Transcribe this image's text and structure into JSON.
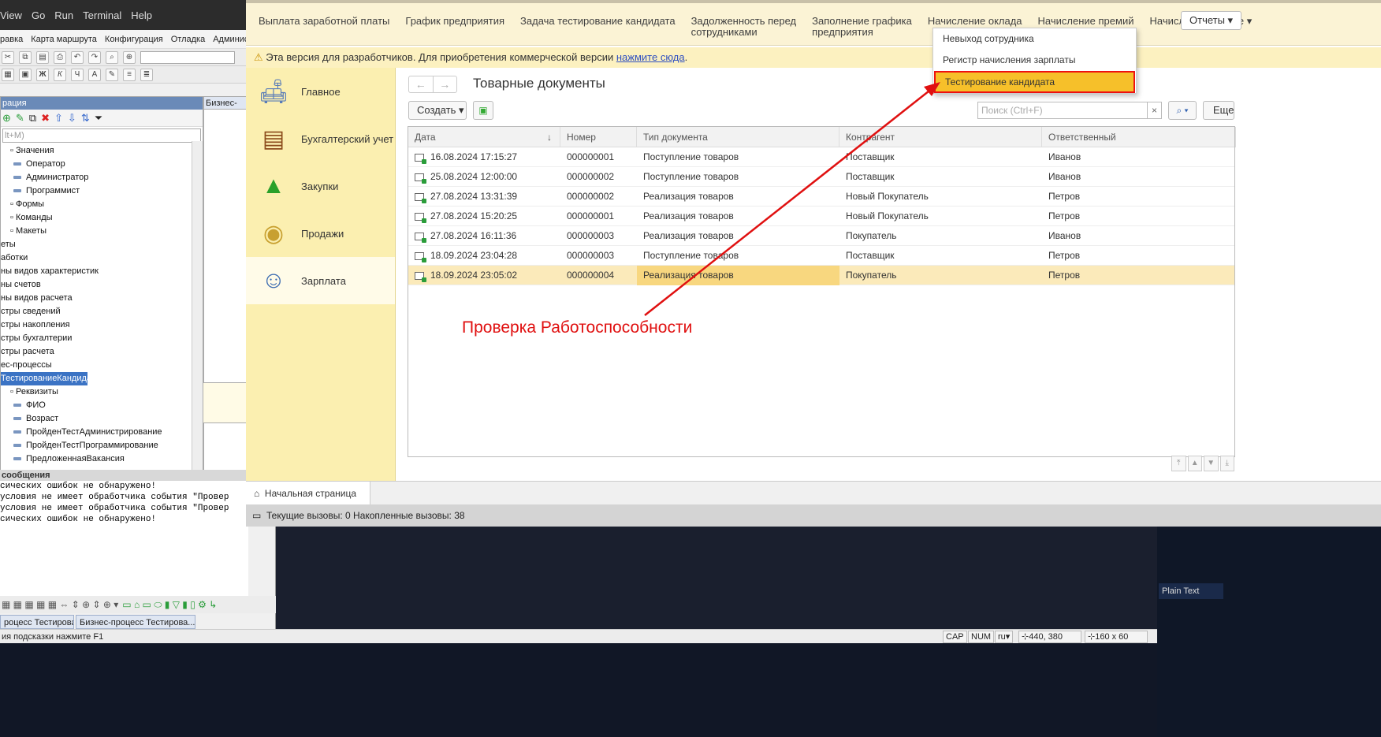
{
  "vscode_menu": [
    "View",
    "Go",
    "Run",
    "Terminal",
    "Help"
  ],
  "configurator": {
    "menu": [
      "равка",
      "Карта маршрута",
      "Конфигурация",
      "Отладка",
      "Администрирова"
    ],
    "tree_title": "рация",
    "tree_search_placeholder": "lt+M)",
    "tree_items": [
      {
        "label": "Значения",
        "indent": 0,
        "kind": "node"
      },
      {
        "label": "Оператор",
        "indent": 1,
        "kind": "leaf"
      },
      {
        "label": "Администратор",
        "indent": 1,
        "kind": "leaf"
      },
      {
        "label": "Программист",
        "indent": 1,
        "kind": "leaf"
      },
      {
        "label": "Формы",
        "indent": 0,
        "kind": "node"
      },
      {
        "label": "Команды",
        "indent": 0,
        "kind": "node"
      },
      {
        "label": "Макеты",
        "indent": 0,
        "kind": "node"
      },
      {
        "label": "еты",
        "indent": -1,
        "kind": "plain"
      },
      {
        "label": "аботки",
        "indent": -1,
        "kind": "plain"
      },
      {
        "label": "ны видов характеристик",
        "indent": -1,
        "kind": "plain"
      },
      {
        "label": "ны счетов",
        "indent": -1,
        "kind": "plain"
      },
      {
        "label": "ны видов расчета",
        "indent": -1,
        "kind": "plain"
      },
      {
        "label": "стры сведений",
        "indent": -1,
        "kind": "plain"
      },
      {
        "label": "стры накопления",
        "indent": -1,
        "kind": "plain"
      },
      {
        "label": "стры бухгалтерии",
        "indent": -1,
        "kind": "plain"
      },
      {
        "label": "стры расчета",
        "indent": -1,
        "kind": "plain"
      },
      {
        "label": "ес-процессы",
        "indent": -1,
        "kind": "plain"
      },
      {
        "label": "ТестированиеКандидата",
        "indent": -1,
        "kind": "selected"
      },
      {
        "label": "Реквизиты",
        "indent": 0,
        "kind": "node"
      },
      {
        "label": "ФИО",
        "indent": 1,
        "kind": "leaf"
      },
      {
        "label": "Возраст",
        "indent": 1,
        "kind": "leaf"
      },
      {
        "label": "ПройденТестАдминистрирование",
        "indent": 1,
        "kind": "leaf"
      },
      {
        "label": "ПройденТестПрограммирование",
        "indent": 1,
        "kind": "leaf"
      },
      {
        "label": "ПредложеннаяВакансия",
        "indent": 1,
        "kind": "leaf"
      }
    ],
    "biz_tab": "Бизнес-",
    "messages_title": "сообщения",
    "messages": [
      "сических ошибок не обнаружено!",
      "условия не имеет обработчика события \"Провер",
      "условия не имеет обработчика события \"Провер",
      "сических ошибок не обнаружено!"
    ],
    "tasks": [
      "роцесс Тестирова...",
      "Бизнес-процесс Тестирова..."
    ],
    "status_hint": "ия подсказки нажмите F1",
    "status_cap": "CAP",
    "status_num": "NUM",
    "status_lang": "ru▾",
    "status_pos": "440, 380",
    "status_size": "160 x 60"
  },
  "enterprise": {
    "top_nav": [
      "Выплата заработной платы",
      "График предприятия",
      "Задача тестирование кандидата",
      "Задолженность перед\nсотрудниками",
      "Заполнение графика\nпредприятия",
      "Начисление оклада",
      "Начисление премий",
      "Начисления",
      "Еще ▾"
    ],
    "reports_label": "Отчеты ▾",
    "warning_text": "Эта версия для разработчиков. Для приобретения коммерческой версии ",
    "warning_link": "нажмите сюда",
    "warning_tail": ".",
    "sections": [
      {
        "label": "Главное",
        "icon": "desk-lamp-icon"
      },
      {
        "label": "Бухгалтерский учет",
        "icon": "cabinet-icon"
      },
      {
        "label": "Закупки",
        "icon": "green-arrow-up-icon"
      },
      {
        "label": "Продажи",
        "icon": "coins-icon"
      },
      {
        "label": "Зарплата",
        "icon": "person-icon"
      }
    ],
    "doc_title": "Товарные документы",
    "create_label": "Создать ▾",
    "search_placeholder": "Поиск (Ctrl+F)",
    "more_label": "Еще",
    "columns": [
      "Дата",
      "Номер",
      "Тип документа",
      "Контрагент",
      "Ответственный"
    ],
    "rows": [
      [
        "16.08.2024 17:15:27",
        "000000001",
        "Поступление товаров",
        "Поставщик",
        "Иванов"
      ],
      [
        "25.08.2024 12:00:00",
        "000000002",
        "Поступление товаров",
        "Поставщик",
        "Иванов"
      ],
      [
        "27.08.2024 13:31:39",
        "000000002",
        "Реализация товаров",
        "Новый Покупатель",
        "Петров"
      ],
      [
        "27.08.2024 15:20:25",
        "000000001",
        "Реализация товаров",
        "Новый Покупатель",
        "Петров"
      ],
      [
        "27.08.2024 16:11:36",
        "000000003",
        "Реализация товаров",
        "Покупатель",
        "Иванов"
      ],
      [
        "18.09.2024 23:04:28",
        "000000003",
        "Поступление товаров",
        "Поставщик",
        "Петров"
      ],
      [
        "18.09.2024 23:05:02",
        "000000004",
        "Реализация товаров",
        "Покупатель",
        "Петров"
      ]
    ],
    "selected_row": 6,
    "home_tab": "Начальная страница",
    "calls_text": "Текущие вызовы: 0   Накопленные вызовы: 38",
    "dropdown": [
      "Невыход сотрудника",
      "Регистр начисления зарплаты",
      "Тестирование кандидата"
    ],
    "dropdown_active": 2
  },
  "annotation": "Проверка Работоспособности",
  "plain_text_label": "Plain Text",
  "colors": {
    "accent_yellow": "#fbf3d5",
    "highlight": "#f6c02a",
    "annotation_red": "#e01010"
  }
}
